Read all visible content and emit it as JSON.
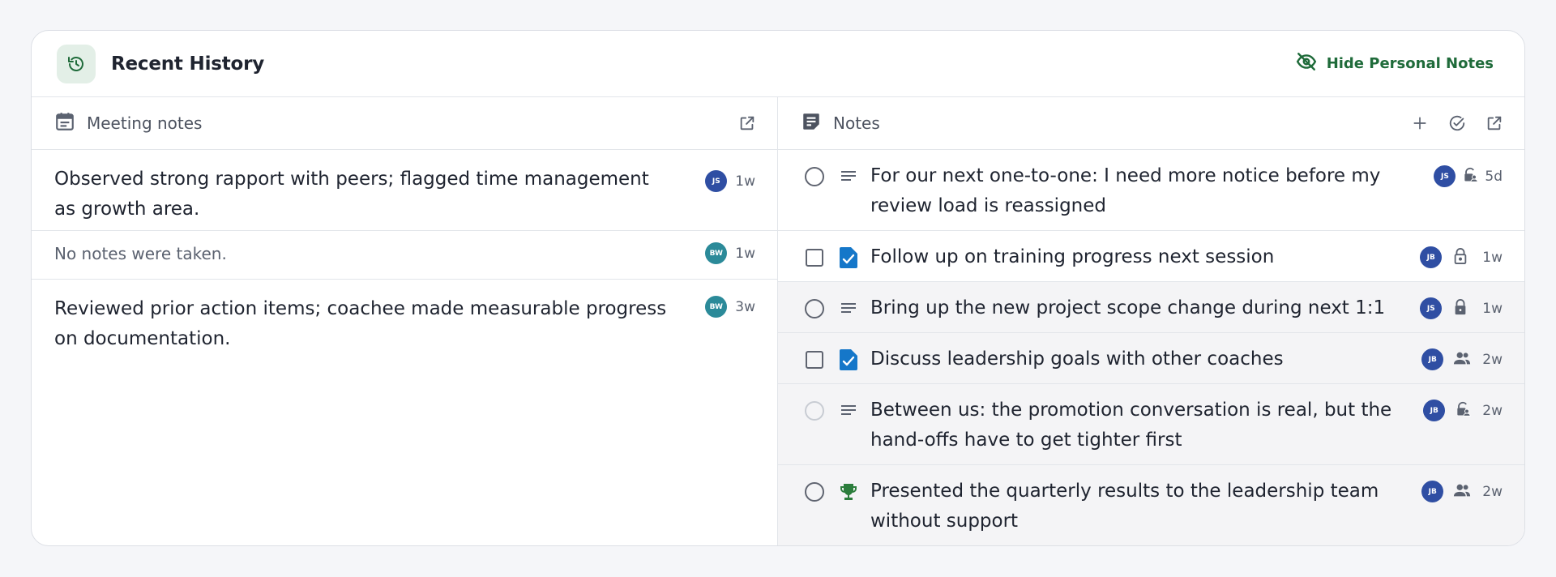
{
  "header": {
    "title": "Recent History",
    "hide_label": "Hide Personal Notes",
    "history_icon": "history-icon",
    "hide_icon": "eye-off-icon"
  },
  "meeting_notes": {
    "title": "Meeting notes",
    "icon": "calendar-icon",
    "items": [
      {
        "text": "Observed strong rapport with peers; flagged time management as growth area.",
        "initials": "JS",
        "ago": "1w",
        "avatar_color": "#2f4ea3"
      },
      {
        "text": "No notes were taken.",
        "initials": "BW",
        "ago": "1w",
        "avatar_color": "#2b8a99"
      },
      {
        "text": "Reviewed prior action items; coachee made measurable progress on documentation.",
        "initials": "BW",
        "ago": "3w",
        "avatar_color": "#2b8a99"
      }
    ]
  },
  "notes": {
    "title": "Notes",
    "icon": "sticky-note-icon",
    "items": [
      {
        "text": "For our next one-to-one: I need more notice before my review load is reassigned",
        "control": "radio",
        "type": "text-lines-icon",
        "initials": "JS",
        "privacy": "lock-person-icon",
        "ago": "5d"
      },
      {
        "text": "Follow up on training progress next session",
        "control": "checkbox",
        "type": "task-doc-icon",
        "initials": "JB",
        "privacy": "lock-outline-icon",
        "ago": "1w"
      },
      {
        "text": "Bring up the new project scope change during next 1:1",
        "control": "radio",
        "type": "text-lines-icon",
        "initials": "JS",
        "privacy": "lock-icon",
        "ago": "1w"
      },
      {
        "text": "Discuss leadership goals with other coaches",
        "control": "checkbox",
        "type": "task-doc-icon",
        "initials": "JB",
        "privacy": "people-icon",
        "ago": "2w"
      },
      {
        "text": "Between us: the promotion conversation is real, but the hand-offs have to get tighter first",
        "control": "radio-light",
        "type": "text-lines-icon",
        "initials": "JB",
        "privacy": "lock-person-icon",
        "ago": "2w"
      },
      {
        "text": "Presented the quarterly results to the leadership team without support",
        "control": "radio",
        "type": "trophy-icon",
        "initials": "JB",
        "privacy": "people-icon",
        "ago": "2w"
      }
    ]
  },
  "colors": {
    "accent_green": "#1f6b3a",
    "avatar_blue": "#2f4ea3",
    "avatar_teal": "#2b8a99",
    "task_blue": "#1577c9",
    "trophy_green": "#2b7d3c"
  }
}
